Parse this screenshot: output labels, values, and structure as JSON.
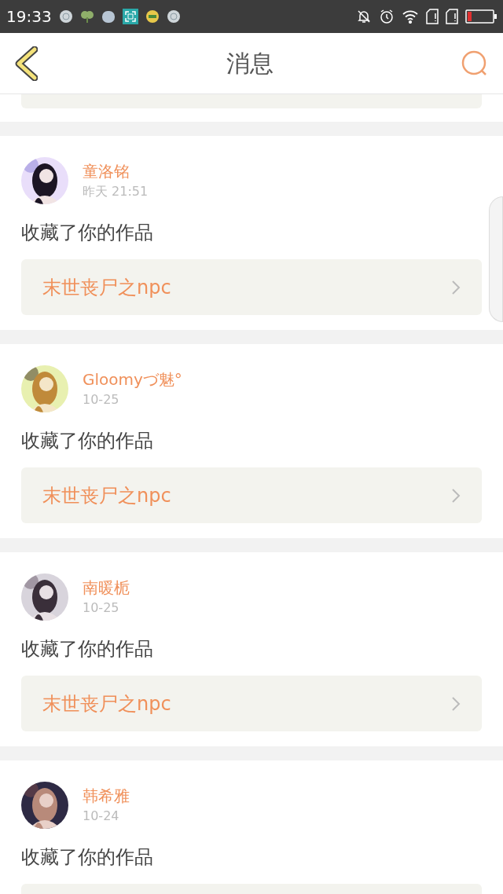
{
  "status_bar": {
    "time": "19:33"
  },
  "header": {
    "title": "消息"
  },
  "messages": [
    {
      "user": "童洛铭",
      "time": "昨天 21:51",
      "action": "收藏了你的作品",
      "work": "末世丧尸之npc"
    },
    {
      "user": "Gloomyづ魅°",
      "time": "10-25",
      "action": "收藏了你的作品",
      "work": "末世丧尸之npc"
    },
    {
      "user": "南暖栀",
      "time": "10-25",
      "action": "收藏了你的作品",
      "work": "末世丧尸之npc"
    },
    {
      "user": "韩希雅",
      "time": "10-24",
      "action": "收藏了你的作品"
    }
  ]
}
